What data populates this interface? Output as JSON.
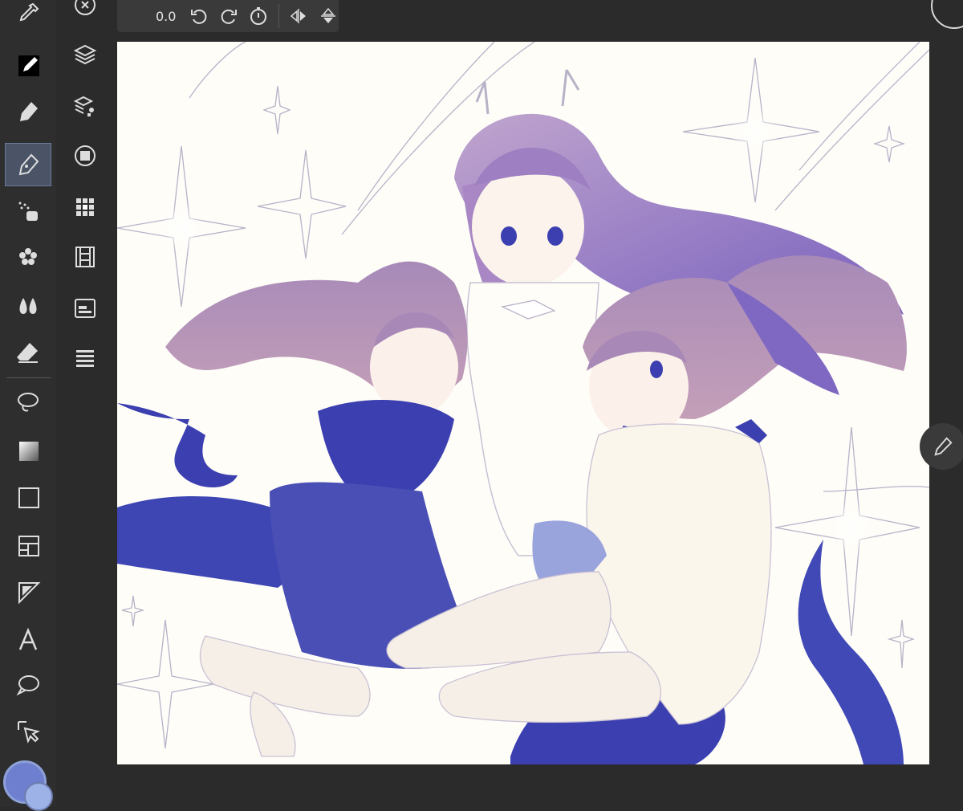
{
  "toolbar": {
    "rotation_value": "0.0",
    "controls": [
      "undo-rotate",
      "redo-rotate",
      "reset-rotation",
      "flip-horizontal",
      "flip-vertical"
    ]
  },
  "tools": [
    {
      "name": "eyedropper-tool",
      "icon": "eyedropper-icon"
    },
    {
      "name": "brush-tool",
      "icon": "brush-icon"
    },
    {
      "name": "pen-tool",
      "icon": "pen-nib-icon"
    },
    {
      "name": "pencil-tool",
      "icon": "pencil-nib-icon",
      "active": true
    },
    {
      "name": "airbrush-tool",
      "icon": "airbrush-icon"
    },
    {
      "name": "decoration-tool",
      "icon": "flower-icon"
    },
    {
      "name": "blend-tool",
      "icon": "blend-drops-icon"
    },
    {
      "name": "eraser-tool",
      "icon": "eraser-icon"
    },
    {
      "name": "selection-lasso-tool",
      "icon": "lasso-icon"
    },
    {
      "name": "gradient-tool",
      "icon": "gradient-icon"
    },
    {
      "name": "figure-tool",
      "icon": "rectangle-icon"
    },
    {
      "name": "frame-border-tool",
      "icon": "frame-icon"
    },
    {
      "name": "ruler-tool",
      "icon": "ruler-triangle-icon"
    },
    {
      "name": "text-tool",
      "icon": "text-icon"
    },
    {
      "name": "balloon-tool",
      "icon": "speech-balloon-icon"
    },
    {
      "name": "operation-tool",
      "icon": "arrow-pointer-icon"
    }
  ],
  "palettes": [
    {
      "name": "navigator-button",
      "icon": "compass-icon"
    },
    {
      "name": "layer-button",
      "icon": "layers-icon"
    },
    {
      "name": "layer-property-button",
      "icon": "layer-property-icon"
    },
    {
      "name": "tool-property-button",
      "icon": "circle-square-icon"
    },
    {
      "name": "sub-tool-button",
      "icon": "grid-icon"
    },
    {
      "name": "timeline-button",
      "icon": "film-icon"
    },
    {
      "name": "material-button",
      "icon": "panel-icon"
    },
    {
      "name": "menu-list-button",
      "icon": "list-icon"
    }
  ],
  "colors": {
    "main": "#6f7fcf",
    "sub": "#9db2e6",
    "canvas": "#fefdf8",
    "accent": "#3b3fb0"
  }
}
